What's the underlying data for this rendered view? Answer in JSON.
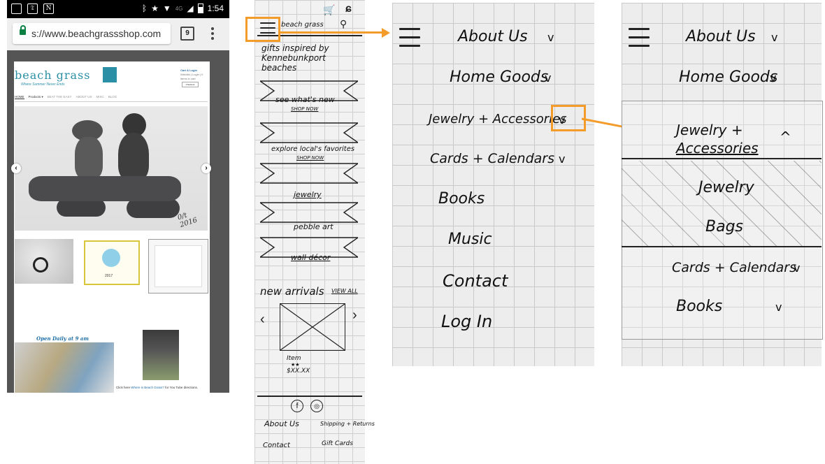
{
  "phone": {
    "status": {
      "clock": "1:54",
      "network": "4G"
    },
    "browser": {
      "url": "s://www.beachgrassshop.com",
      "tab_count": "9"
    },
    "site": {
      "logo": "beach grass",
      "tagline": "Where Summer Never Ends",
      "account_link": "Cart & Login",
      "account_sub": "Wishlist | Login | 0 items in cart",
      "checkout": "Checkout",
      "nav": [
        "HOME",
        "Products ▾",
        "BEAT THE EASY",
        "ABOUT US",
        "MISC",
        "BLOG"
      ],
      "hero_signature": "0/t 2016",
      "thumb_year": "2017",
      "open_daily": "Open Daily at 9 am",
      "directions_prefix": "Click here",
      "directions_link": "Where is Beach Grass?",
      "directions_suffix": "for You Tube directions."
    }
  },
  "sketch": {
    "brand": "beach grass",
    "headline": "gifts inspired by Kennebunkport beaches",
    "banners": [
      {
        "title": "see what's new",
        "link": "SHOP NOW"
      },
      {
        "title": "explore local's favorites",
        "link": "SHOP NOW"
      },
      {
        "title": "jewelry",
        "link": ""
      },
      {
        "title": "pebble art",
        "link": ""
      },
      {
        "title": "wall décor",
        "link": ""
      }
    ],
    "new_arrivals": "new arrivals",
    "view_all": "VIEW ALL",
    "item_name": "Item",
    "item_stars": "★★",
    "item_price": "$XX.XX",
    "footer_links": [
      "About Us",
      "Shipping + Returns",
      "Contact",
      "Gift Cards"
    ]
  },
  "menu1": {
    "items": [
      {
        "label": "About Us",
        "chevron": "v"
      },
      {
        "label": "Home Goods",
        "chevron": "v"
      },
      {
        "label": "Jewelry + Accessories",
        "chevron": "v"
      },
      {
        "label": "Cards + Calendars",
        "chevron": "v"
      },
      {
        "label": "Books",
        "chevron": ""
      },
      {
        "label": "Music",
        "chevron": ""
      },
      {
        "label": "Contact",
        "chevron": ""
      },
      {
        "label": "Log In",
        "chevron": ""
      }
    ]
  },
  "menu2": {
    "items": [
      {
        "label": "About Us",
        "chevron": "v"
      },
      {
        "label": "Home Goods",
        "chevron": "v"
      }
    ],
    "expanded_label_1": "Jewelry +",
    "expanded_label_2": "Accessories",
    "expanded_chevron": "^",
    "subitems": [
      "Jewelry",
      "Bags"
    ],
    "after": [
      {
        "label": "Cards + Calendars",
        "chevron": "v"
      },
      {
        "label": "Books",
        "chevron": "v"
      }
    ]
  },
  "colors": {
    "accent": "#f39c2a",
    "brand": "#2b8fa6"
  }
}
